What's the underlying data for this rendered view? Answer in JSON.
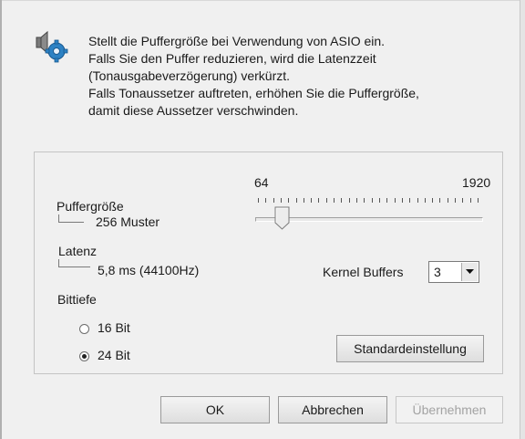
{
  "info": {
    "icon": "speaker-gear-icon",
    "lines": [
      "Stellt die Puffergröße bei Verwendung von ASIO ein.",
      "Falls Sie den Puffer reduzieren, wird die Latenzzeit",
      "(Tonausgabeverzögerung) verkürzt.",
      "Falls Tonaussetzer auftreten, erhöhen Sie die Puffergröße,",
      "damit diese Aussetzer verschwinden."
    ]
  },
  "buffer": {
    "label": "Puffergröße",
    "value": "256 Muster",
    "slider_min_label": "64",
    "slider_max_label": "1920",
    "slider_value": 256
  },
  "latency": {
    "label": "Latenz",
    "value": "5,8 ms (44100Hz)"
  },
  "kernel_buffers": {
    "label": "Kernel Buffers",
    "value": "3"
  },
  "bit_depth": {
    "label": "Bittiefe",
    "options": [
      {
        "label": "16 Bit",
        "checked": false
      },
      {
        "label": "24 Bit",
        "checked": true
      }
    ]
  },
  "buttons": {
    "default": "Standardeinstellung",
    "ok": "OK",
    "cancel": "Abbrechen",
    "apply": "Übernehmen"
  }
}
